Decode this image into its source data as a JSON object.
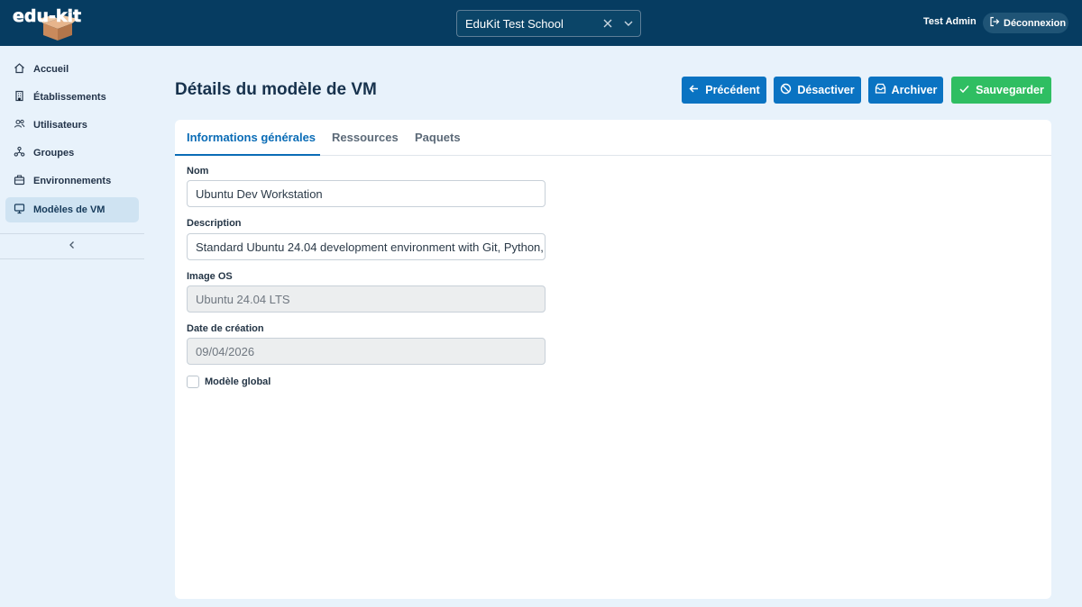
{
  "brand": {
    "logo_text": "edu-kit"
  },
  "header": {
    "school_select": {
      "value": "EduKit Test School"
    },
    "user_name": "Test Admin",
    "logout_label": "Déconnexion"
  },
  "sidebar": {
    "items": [
      {
        "label": "Accueil",
        "icon": "home-icon",
        "active": false
      },
      {
        "label": "Établissements",
        "icon": "building-icon",
        "active": false
      },
      {
        "label": "Utilisateurs",
        "icon": "users-icon",
        "active": false
      },
      {
        "label": "Groupes",
        "icon": "groups-icon",
        "active": false
      },
      {
        "label": "Environnements",
        "icon": "environment-icon",
        "active": false
      },
      {
        "label": "Modèles de VM",
        "icon": "monitor-icon",
        "active": true
      }
    ]
  },
  "page": {
    "title": "Détails du modèle de VM",
    "actions": {
      "previous": "Précédent",
      "deactivate": "Désactiver",
      "archive": "Archiver",
      "save": "Sauvegarder"
    }
  },
  "tabs": [
    {
      "label": "Informations générales",
      "active": true
    },
    {
      "label": "Ressources",
      "active": false
    },
    {
      "label": "Paquets",
      "active": false
    }
  ],
  "form": {
    "name": {
      "label": "Nom",
      "value": "Ubuntu Dev Workstation"
    },
    "description": {
      "label": "Description",
      "value": "Standard Ubuntu 24.04 development environment with Git, Python,"
    },
    "os_image": {
      "label": "Image OS",
      "value": "Ubuntu 24.04 LTS"
    },
    "created": {
      "label": "Date de création",
      "value": "09/04/2026"
    },
    "global_model": {
      "label": "Modèle global",
      "checked": false
    }
  },
  "colors": {
    "topbar": "#063c61",
    "primary": "#0a73c2",
    "success": "#2fbe62",
    "background": "#e8f2fb"
  }
}
